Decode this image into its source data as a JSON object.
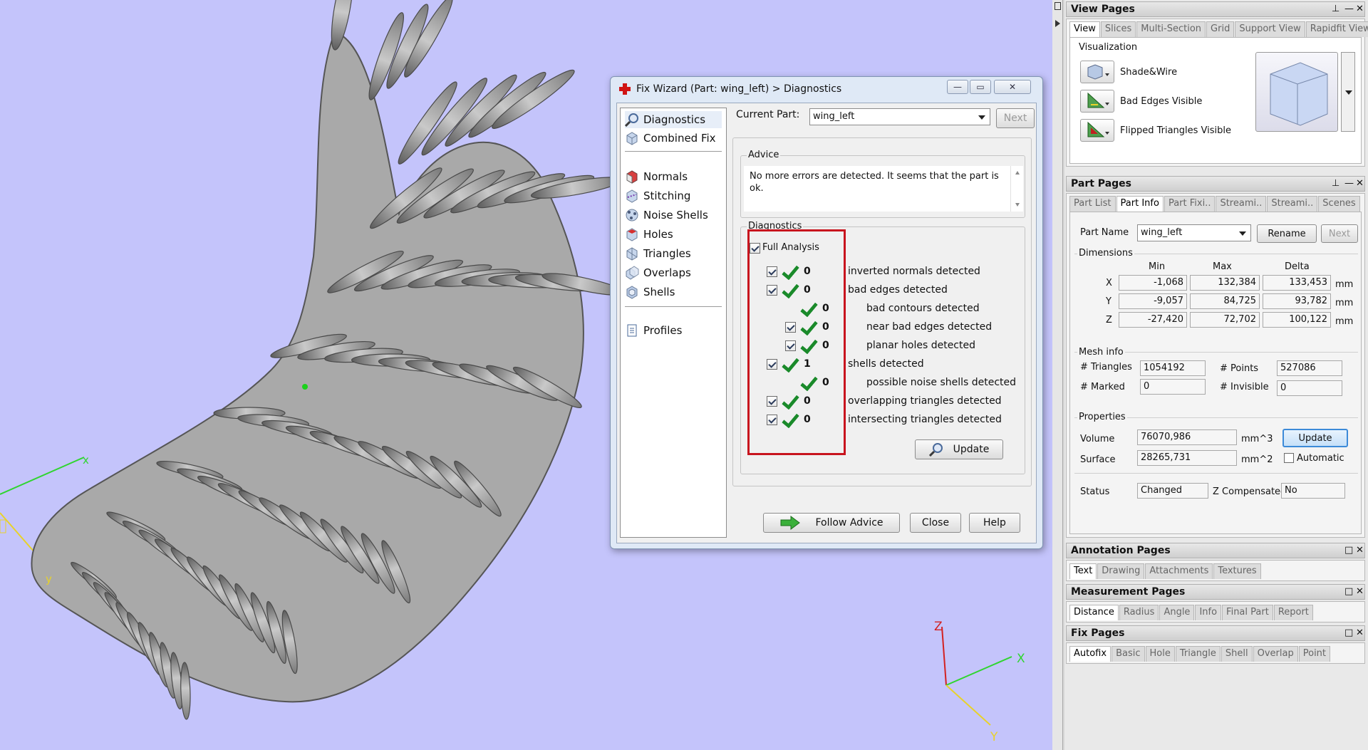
{
  "viewport": {
    "axis_labels": {
      "x": "X",
      "y": "Y",
      "z": "Z",
      "left_x": "x",
      "left_y": "y"
    },
    "colors": {
      "background": "#c4c4fb",
      "mesh": "#8c8c8c",
      "axis_x": "#2fd52f",
      "axis_y": "#e8d22a",
      "axis_z": "#d32222"
    }
  },
  "dialog": {
    "title": "Fix Wizard (Part: wing_left) > Diagnostics",
    "window_buttons": {
      "minimize": "—",
      "maximize": "▭",
      "close": "✕"
    },
    "nav": {
      "top": [
        {
          "label": "Diagnostics",
          "icon": "magnifier-icon"
        },
        {
          "label": "Combined Fix",
          "icon": "cube-icon"
        }
      ],
      "tools": [
        {
          "label": "Normals",
          "icon": "normals-icon"
        },
        {
          "label": "Stitching",
          "icon": "stitching-icon"
        },
        {
          "label": "Noise Shells",
          "icon": "noise-shells-icon"
        },
        {
          "label": "Holes",
          "icon": "holes-icon"
        },
        {
          "label": "Triangles",
          "icon": "triangles-icon"
        },
        {
          "label": "Overlaps",
          "icon": "overlaps-icon"
        },
        {
          "label": "Shells",
          "icon": "shells-icon"
        }
      ],
      "bottom": [
        {
          "label": "Profiles",
          "icon": "document-icon"
        }
      ]
    },
    "current_part_label": "Current Part:",
    "current_part_value": "wing_left",
    "next_label": "Next",
    "advice_title": "Advice",
    "advice_text": "No more errors are detected. It seems that the part is ok.",
    "diagnostics_title": "Diagnostics",
    "full_analysis_label": "Full Analysis",
    "rows": [
      {
        "count": "0",
        "label": "inverted normals detected"
      },
      {
        "count": "0",
        "label": "bad edges detected"
      },
      {
        "count": "0",
        "label": "bad contours detected"
      },
      {
        "count": "0",
        "label": "near bad edges detected"
      },
      {
        "count": "0",
        "label": "planar holes detected"
      },
      {
        "count": "1",
        "label": "shells detected"
      },
      {
        "count": "0",
        "label": "possible noise shells detected"
      },
      {
        "count": "0",
        "label": "overlapping triangles detected"
      },
      {
        "count": "0",
        "label": "intersecting triangles detected"
      }
    ],
    "update_label": "Update",
    "follow_advice_label": "Follow Advice",
    "close_label": "Close",
    "help_label": "Help"
  },
  "view_pages": {
    "title": "View Pages",
    "tabs": [
      "View",
      "Slices",
      "Multi-Section",
      "Grid",
      "Support View",
      "Rapidfit View"
    ],
    "visualization_title": "Visualization",
    "items": [
      "Shade&Wire",
      "Bad Edges Visible",
      "Flipped Triangles Visible"
    ]
  },
  "part_pages": {
    "title": "Part Pages",
    "tabs": [
      "Part List",
      "Part Info",
      "Part Fixi..",
      "Streami..",
      "Streami..",
      "Scenes"
    ],
    "part_name_label": "Part Name",
    "part_name_value": "wing_left",
    "rename_label": "Rename",
    "next_label": "Next",
    "dimensions_title": "Dimensions",
    "dim_headers": [
      "Min",
      "Max",
      "Delta"
    ],
    "dims": [
      {
        "axis": "X",
        "min": "-1,068",
        "max": "132,384",
        "delta": "133,453",
        "unit": "mm"
      },
      {
        "axis": "Y",
        "min": "-9,057",
        "max": "84,725",
        "delta": "93,782",
        "unit": "mm"
      },
      {
        "axis": "Z",
        "min": "-27,420",
        "max": "72,702",
        "delta": "100,122",
        "unit": "mm"
      }
    ],
    "mesh_title": "Mesh info",
    "triangles_label": "# Triangles",
    "triangles_value": "1054192",
    "points_label": "# Points",
    "points_value": "527086",
    "marked_label": "# Marked",
    "marked_value": "0",
    "invisible_label": "# Invisible",
    "invisible_value": "0",
    "properties_title": "Properties",
    "volume_label": "Volume",
    "volume_value": "76070,986",
    "volume_unit": "mm^3",
    "surface_label": "Surface",
    "surface_value": "28265,731",
    "surface_unit": "mm^2",
    "update_label": "Update",
    "automatic_label": "Automatic",
    "status_label": "Status",
    "status_value": "Changed",
    "zcomp_label": "Z Compensated",
    "zcomp_value": "No"
  },
  "annotation_pages": {
    "title": "Annotation Pages",
    "tabs": [
      "Text",
      "Drawing",
      "Attachments",
      "Textures"
    ]
  },
  "measurement_pages": {
    "title": "Measurement Pages",
    "tabs": [
      "Distance",
      "Radius",
      "Angle",
      "Info",
      "Final Part",
      "Report"
    ]
  },
  "fix_pages": {
    "title": "Fix Pages",
    "tabs": [
      "Autofix",
      "Basic",
      "Hole",
      "Triangle",
      "Shell",
      "Overlap",
      "Point"
    ]
  }
}
